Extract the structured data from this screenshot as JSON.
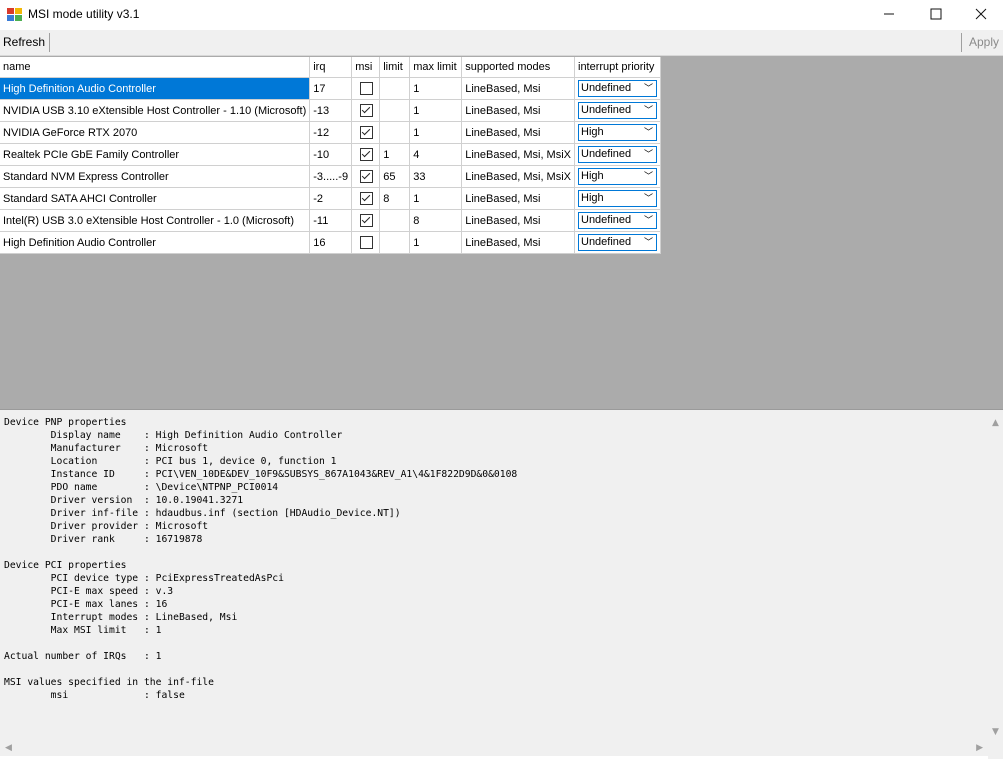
{
  "window": {
    "title": "MSI mode utility v3.1",
    "minimize": "—",
    "maximize": "☐",
    "close": "✕"
  },
  "toolbar": {
    "refresh_label": "Refresh",
    "apply_label": "Apply"
  },
  "grid": {
    "columns": [
      "name",
      "irq",
      "msi",
      "limit",
      "max limit",
      "supported modes",
      "interrupt priority"
    ],
    "rows": [
      {
        "name": "High Definition Audio Controller",
        "irq": "17",
        "msi": false,
        "limit": "",
        "max_limit": "1",
        "modes": "LineBased, Msi",
        "priority": "Undefined"
      },
      {
        "name": "NVIDIA USB 3.10 eXtensible Host Controller - 1.10 (Microsoft)",
        "irq": "-13",
        "msi": true,
        "limit": "",
        "max_limit": "1",
        "modes": "LineBased, Msi",
        "priority": "Undefined"
      },
      {
        "name": "NVIDIA GeForce RTX 2070",
        "irq": "-12",
        "msi": true,
        "limit": "",
        "max_limit": "1",
        "modes": "LineBased, Msi",
        "priority": "High"
      },
      {
        "name": "Realtek PCIe GbE Family Controller",
        "irq": "-10",
        "msi": true,
        "limit": "1",
        "max_limit": "4",
        "modes": "LineBased, Msi, MsiX",
        "priority": "Undefined"
      },
      {
        "name": "Standard NVM Express Controller",
        "irq": "-3.....-9",
        "msi": true,
        "limit": "65",
        "max_limit": "33",
        "modes": "LineBased, Msi, MsiX",
        "priority": "High"
      },
      {
        "name": "Standard SATA AHCI Controller",
        "irq": "-2",
        "msi": true,
        "limit": "8",
        "max_limit": "1",
        "modes": "LineBased, Msi",
        "priority": "High"
      },
      {
        "name": "Intel(R) USB 3.0 eXtensible Host Controller - 1.0 (Microsoft)",
        "irq": "-11",
        "msi": true,
        "limit": "",
        "max_limit": "8",
        "modes": "LineBased, Msi",
        "priority": "Undefined"
      },
      {
        "name": "High Definition Audio Controller",
        "irq": "16",
        "msi": false,
        "limit": "",
        "max_limit": "1",
        "modes": "LineBased, Msi",
        "priority": "Undefined"
      }
    ]
  },
  "details": {
    "text": "Device PNP properties\n        Display name    : High Definition Audio Controller\n        Manufacturer    : Microsoft\n        Location        : PCI bus 1, device 0, function 1\n        Instance ID     : PCI\\VEN_10DE&DEV_10F9&SUBSYS_867A1043&REV_A1\\4&1F822D9D&0&0108\n        PDO name        : \\Device\\NTPNP_PCI0014\n        Driver version  : 10.0.19041.3271\n        Driver inf-file : hdaudbus.inf (section [HDAudio_Device.NT])\n        Driver provider : Microsoft\n        Driver rank     : 16719878\n\nDevice PCI properties\n        PCI device type : PciExpressTreatedAsPci\n        PCI-E max speed : v.3\n        PCI-E max lanes : 16\n        Interrupt modes : LineBased, Msi\n        Max MSI limit   : 1\n\nActual number of IRQs   : 1\n\nMSI values specified in the inf-file\n        msi             : false"
  },
  "colors": {
    "selection": "#0078d7",
    "grid_background": "#ababab",
    "panel_background": "#f0f0f0"
  }
}
